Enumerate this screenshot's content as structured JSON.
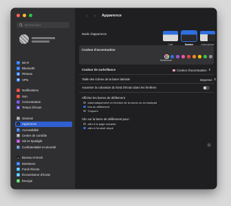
{
  "window": {
    "title": "Apparence"
  },
  "search": {
    "placeholder": "Rechercher"
  },
  "sidebar": {
    "items": [
      {
        "label": "Wi-Fi",
        "color": "#2f7cf6",
        "glyph": "≈"
      },
      {
        "label": "Bluetooth",
        "color": "#2f7cf6",
        "glyph": "ᛒ"
      },
      {
        "label": "Réseau",
        "color": "#2f7cf6",
        "glyph": "◉"
      },
      {
        "label": "VPN",
        "color": "#2f7cf6",
        "glyph": "▣"
      },
      {
        "label": "Notifications",
        "color": "#e5483e",
        "glyph": "▪"
      },
      {
        "label": "Son",
        "color": "#e5483e",
        "glyph": "♪"
      },
      {
        "label": "Concentration",
        "color": "#6a4fd8",
        "glyph": "☾"
      },
      {
        "label": "Temps d'écran",
        "color": "#6a4fd8",
        "glyph": "⧗"
      },
      {
        "label": "Général",
        "color": "#8e8e93",
        "glyph": "⚙"
      },
      {
        "label": "Apparence",
        "color": "#1c1c1e",
        "glyph": "◐",
        "selected": true
      },
      {
        "label": "Accessibilité",
        "color": "#2f7cf6",
        "glyph": "♿"
      },
      {
        "label": "Centre de contrôle",
        "color": "#8e8e93",
        "glyph": "▤"
      },
      {
        "label": "Siri et Spotlight",
        "color": "#b04fd8",
        "glyph": "●"
      },
      {
        "label": "Confidentialité et sécurité",
        "color": "#2f7cf6",
        "glyph": "✋"
      },
      {
        "label": "Bureau et Dock",
        "color": "#1c1c1e",
        "glyph": "▭"
      },
      {
        "label": "Moniteurs",
        "color": "#2f7cf6",
        "glyph": "▭"
      },
      {
        "label": "Fond d'écran",
        "color": "#35b0e8",
        "glyph": "✿"
      },
      {
        "label": "Économiseur d'écran",
        "color": "#35b0e8",
        "glyph": "▨"
      },
      {
        "label": "Énergie",
        "color": "#3fbf4f",
        "glyph": "▮"
      }
    ]
  },
  "appearance": {
    "label": "Mode d'apparence",
    "themes": [
      {
        "label": "Clair",
        "selected": false
      },
      {
        "label": "Sombre",
        "selected": true
      },
      {
        "label": "Automatique",
        "selected": false
      }
    ]
  },
  "accent": {
    "label": "Couleur d'accentuation",
    "caption": "Multicolore",
    "colors": [
      "#b04fd8",
      "#2f6fe0",
      "#9b59d0",
      "#e95c9c",
      "#e5483e",
      "#f08a24",
      "#f5c400",
      "#3fbf4f",
      "#8e8e93"
    ],
    "selected_index": 0
  },
  "highlight": {
    "label": "Couleur de surbrillance",
    "value": "Couleur d'accentuation",
    "chevron": "⇕"
  },
  "sidebar_icon_size": {
    "label": "Taille des icônes de la barre latérale",
    "value": "Moyenne",
    "chevron": "⇕"
  },
  "wallpaper_tinting": {
    "label": "Autoriser la coloration du fond d'écran dans les fenêtres",
    "enabled": false
  },
  "scrollbars": {
    "label": "Afficher les barres de défilement",
    "options": [
      {
        "label": "automatiquement en fonction de la souris ou du trackpad",
        "selected": false
      },
      {
        "label": "lors du défilement",
        "selected": true
      },
      {
        "label": "Toujours",
        "selected": false
      }
    ]
  },
  "scrollclick": {
    "label": "Clic sur la barre de défilement pour :",
    "options": [
      {
        "label": "aller à la page suivante",
        "selected": false
      },
      {
        "label": "aller à l'endroit cliqué",
        "selected": true
      }
    ]
  },
  "help": {
    "glyph": "?"
  }
}
